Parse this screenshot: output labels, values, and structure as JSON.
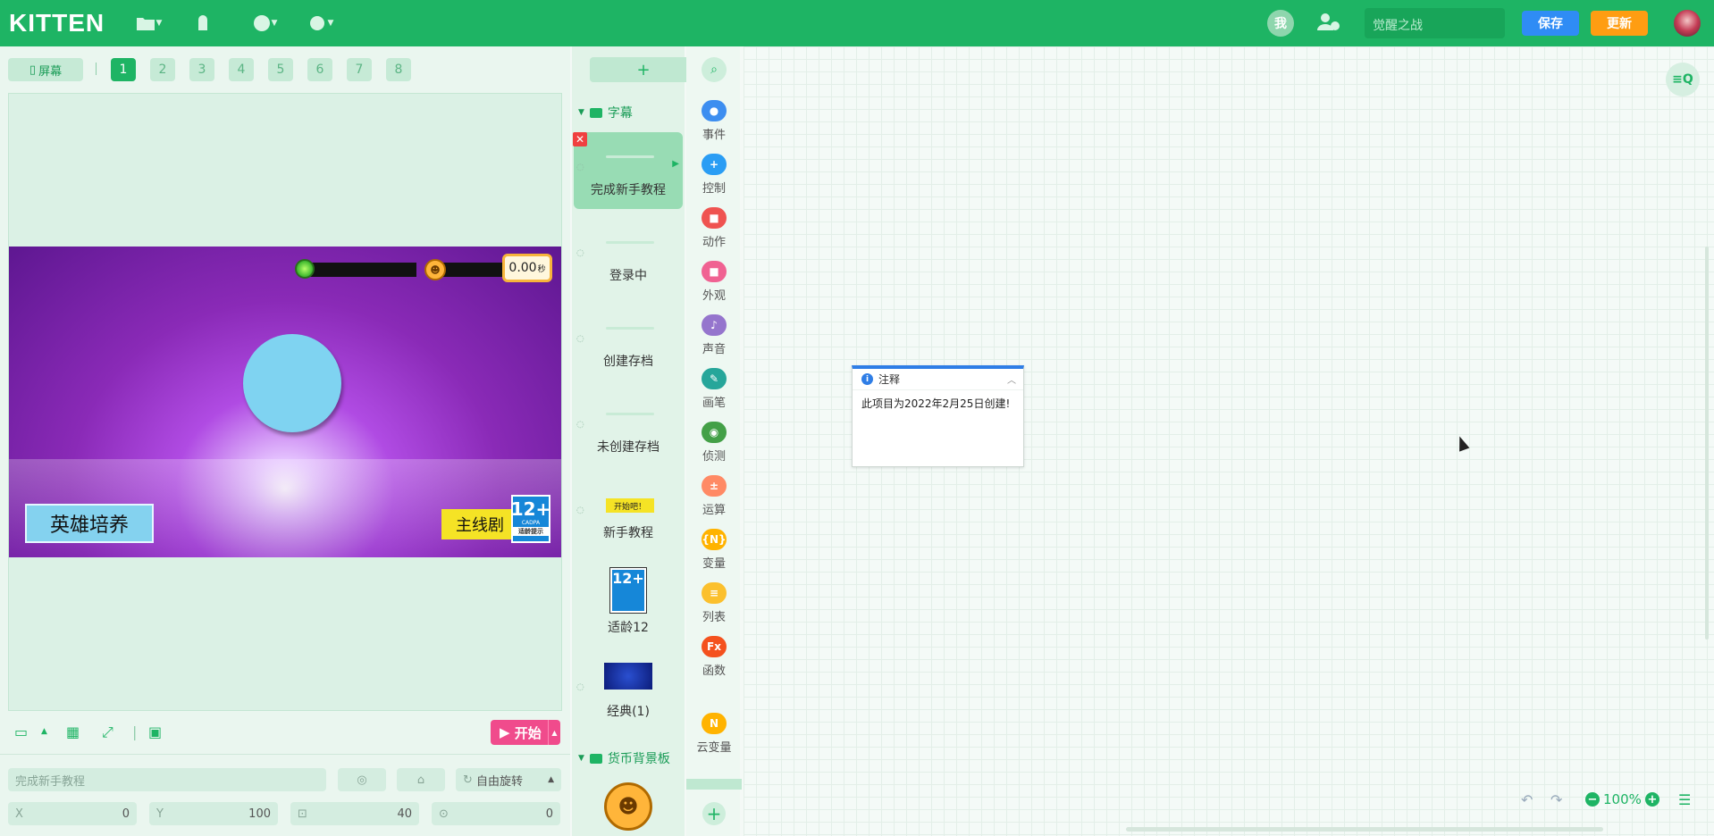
{
  "topbar": {
    "logo": "KITTEN",
    "me_label": "我",
    "project_name_placeholder": "觉醒之战",
    "save_label": "保存",
    "update_label": "更新"
  },
  "stage": {
    "screen_label": "屏幕",
    "pages": [
      "1",
      "2",
      "3",
      "4",
      "5",
      "6",
      "7",
      "8"
    ],
    "active_page": "1",
    "timer_value": "0.00",
    "timer_unit": "秒",
    "hero_button": "英雄培养",
    "main_button": "主线剧",
    "age_big": "12+",
    "age_small": "CADPA",
    "age_foot": "适龄提示",
    "start_label": "开始"
  },
  "props": {
    "name": "完成新手教程",
    "rotation_mode": "自由旋转",
    "x_label": "X",
    "x_value": "0",
    "y_label": "Y",
    "y_value": "100",
    "size_value": "40",
    "dir_value": "0"
  },
  "sprites": {
    "group1": "字幕",
    "items": [
      "完成新手教程",
      "登录中",
      "创建存档",
      "未创建存档",
      "新手教程",
      "适龄12",
      "经典(1)"
    ],
    "tutorial_badge": "开始吧！",
    "group2": "货币背景板"
  },
  "categories": [
    {
      "label": "事件",
      "color": "#3d8ef0"
    },
    {
      "label": "控制",
      "color": "#2a9df4"
    },
    {
      "label": "动作",
      "color": "#ef5350"
    },
    {
      "label": "外观",
      "color": "#f06292"
    },
    {
      "label": "声音",
      "color": "#9575cd"
    },
    {
      "label": "画笔",
      "color": "#26a69a"
    },
    {
      "label": "侦测",
      "color": "#43a047"
    },
    {
      "label": "运算",
      "color": "#ff8a65"
    },
    {
      "label": "变量",
      "color": "#ffb300"
    },
    {
      "label": "列表",
      "color": "#fbc02d"
    },
    {
      "label": "函数",
      "color": "#f4511e"
    },
    {
      "label": "云变量",
      "color": "#ffb300"
    }
  ],
  "note": {
    "title": "注释",
    "body": "此项目为2022年2月25日创建!"
  },
  "workspace": {
    "zoom": "100%"
  }
}
